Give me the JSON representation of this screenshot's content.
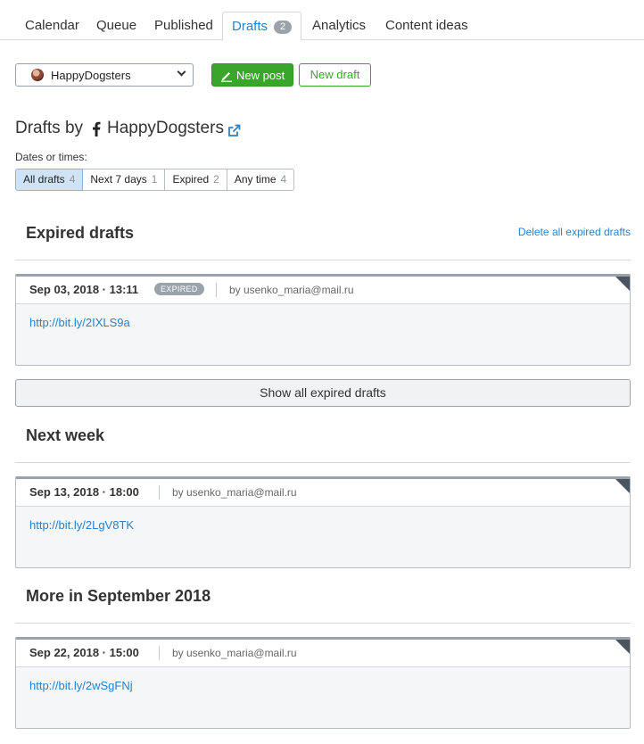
{
  "tabs": [
    {
      "label": "Calendar"
    },
    {
      "label": "Queue"
    },
    {
      "label": "Published"
    },
    {
      "label": "Drafts",
      "badge": "2"
    },
    {
      "label": "Analytics"
    },
    {
      "label": "Content ideas"
    }
  ],
  "toolbar": {
    "account": "HappyDogsters",
    "new_post_label": "New post",
    "new_draft_label": "New draft"
  },
  "heading": {
    "prefix": "Drafts by",
    "account": "HappyDogsters"
  },
  "filters": {
    "label": "Dates or times:",
    "items": [
      {
        "label": "All drafts",
        "count": "4"
      },
      {
        "label": "Next 7 days",
        "count": "1"
      },
      {
        "label": "Expired",
        "count": "2"
      },
      {
        "label": "Any time",
        "count": "4"
      }
    ]
  },
  "sections": {
    "expired": {
      "title": "Expired drafts",
      "action": "Delete all expired drafts",
      "show_all": "Show all expired drafts",
      "card": {
        "date": "Sep 03, 2018 · 13:11",
        "badge": "EXPIRED",
        "author": "by usenko_maria@mail.ru",
        "link": "http://bit.ly/2IXLS9a"
      }
    },
    "next_week": {
      "title": "Next week",
      "card": {
        "date": "Sep 13, 2018 · 18:00",
        "author": "by usenko_maria@mail.ru",
        "link": "http://bit.ly/2LgV8TK"
      }
    },
    "more_september": {
      "title": "More in September 2018",
      "card": {
        "date": "Sep 22, 2018 · 15:00",
        "author": "by usenko_maria@mail.ru",
        "link": "http://bit.ly/2wSgFNj"
      }
    }
  },
  "icons": {
    "pencil": "pencil-icon",
    "facebook": "facebook-icon",
    "external_link": "external-link-icon",
    "chevron": "chevron-down-icon"
  },
  "colors": {
    "accent_green": "#3aa52b",
    "link_blue": "#2f80c4",
    "badge_gray": "#9aa3ab",
    "filter_active": "#cfe3f5"
  }
}
